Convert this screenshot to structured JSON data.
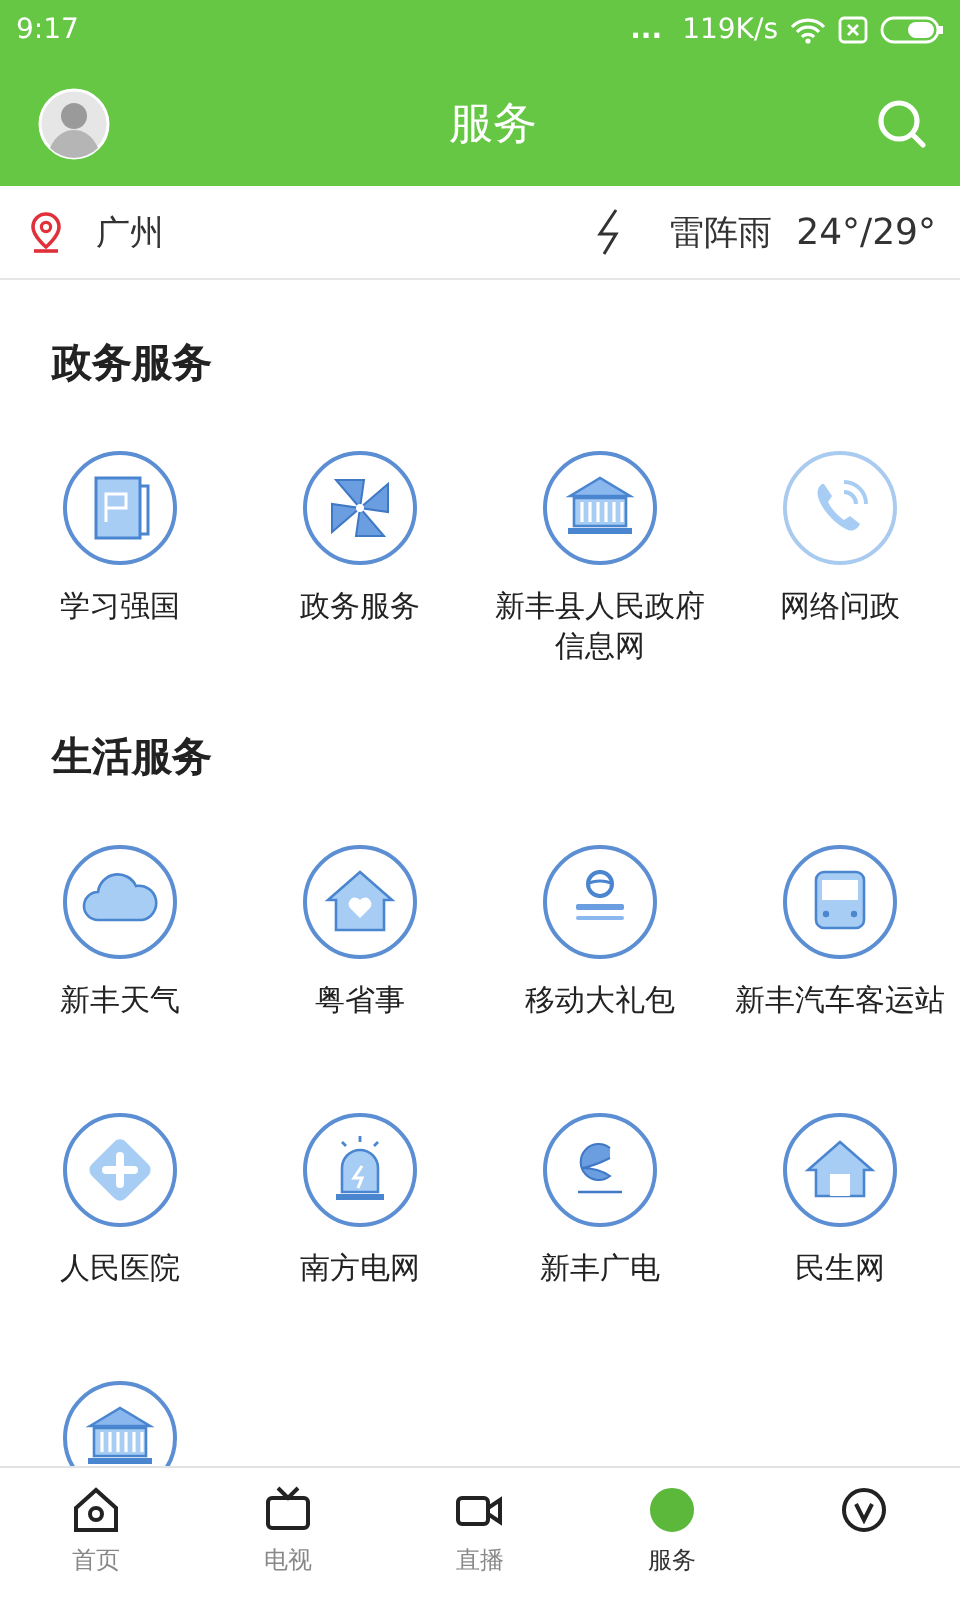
{
  "status_bar": {
    "time": "9:17",
    "dots": "...",
    "speed": "119K/s"
  },
  "header": {
    "title": "服务"
  },
  "location_bar": {
    "city": "广州",
    "weather": "雷阵雨",
    "temperature": "24°/29°"
  },
  "sections": [
    {
      "title": "政务服务",
      "items": [
        {
          "kind": "labeled",
          "label": "学习强国"
        },
        {
          "kind": "labeled",
          "label": "政务服务"
        },
        {
          "kind": "labeled",
          "label": "新丰县人民政府信息网"
        },
        {
          "kind": "labeled",
          "label": "网络问政"
        }
      ]
    },
    {
      "title": "生活服务",
      "items": [
        {
          "kind": "labeled",
          "label": "新丰天气"
        },
        {
          "kind": "labeled",
          "label": "粤省事"
        },
        {
          "kind": "labeled",
          "label": "移动大礼包"
        },
        {
          "kind": "labeled",
          "label": "新丰汽车客运站"
        },
        {
          "kind": "labeled",
          "label": "人民医院"
        },
        {
          "kind": "labeled",
          "label": "南方电网"
        },
        {
          "kind": "labeled",
          "label": "新丰广电"
        },
        {
          "kind": "labeled",
          "label": "民生网"
        },
        {
          "kind": "icon_only"
        }
      ]
    }
  ],
  "bottom_nav": [
    {
      "label": "首页",
      "selected": false
    },
    {
      "label": "电视",
      "selected": false
    },
    {
      "label": "直播",
      "selected": false
    },
    {
      "label": "服务",
      "selected": true
    },
    {
      "selected": false
    }
  ]
}
